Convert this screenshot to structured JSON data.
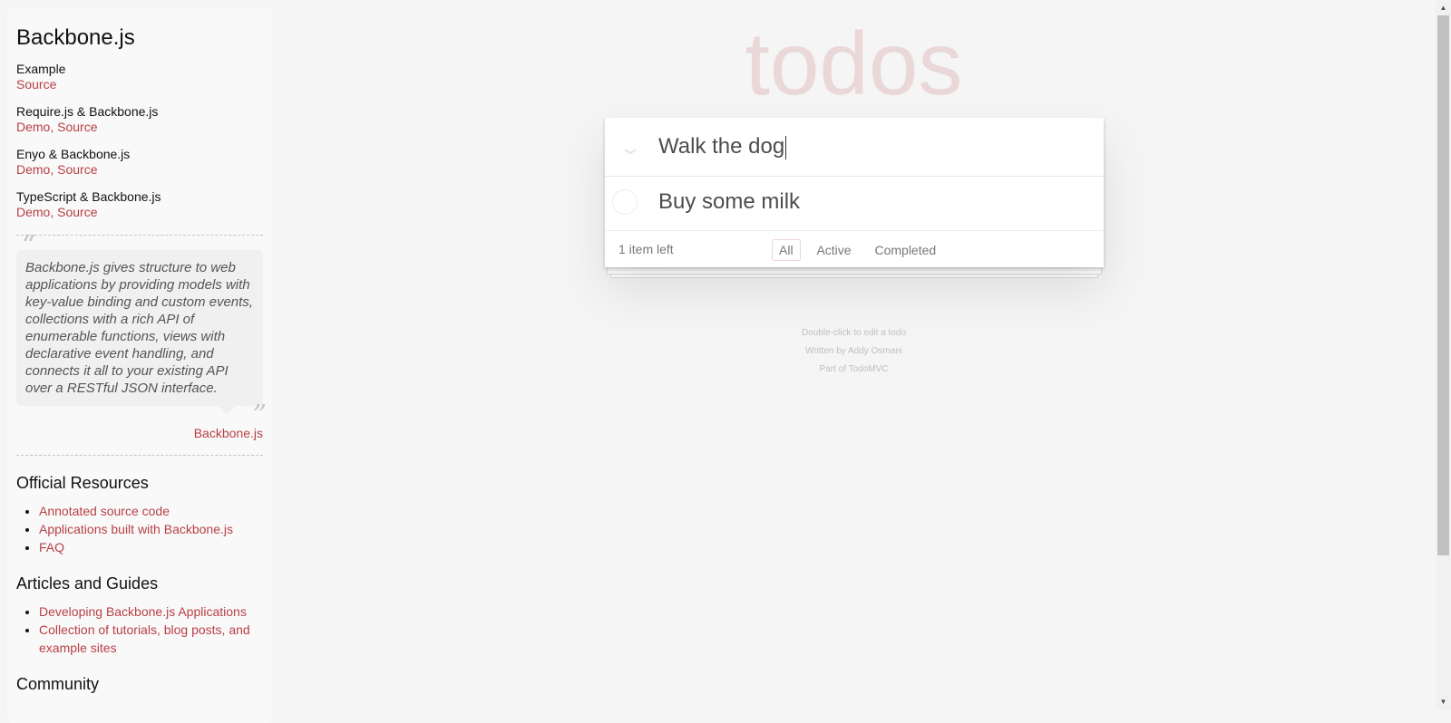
{
  "sidebar": {
    "title": "Backbone.js",
    "examples": [
      {
        "name": "Example",
        "links": "Source"
      },
      {
        "name": "Require.js & Backbone.js",
        "links": "Demo, Source"
      },
      {
        "name": "Enyo & Backbone.js",
        "links": "Demo, Source"
      },
      {
        "name": "TypeScript & Backbone.js",
        "links": "Demo, Source"
      }
    ],
    "quote": "Backbone.js gives structure to web applications by providing models with key-value binding and custom events, collections with a rich API of enumerable functions, views with declarative event handling, and connects it all to your existing API over a RESTful JSON interface.",
    "quote_source": "Backbone.js",
    "official_heading": "Official Resources",
    "official_items": [
      "Annotated source code",
      "Applications built with Backbone.js",
      "FAQ"
    ],
    "articles_heading": "Articles and Guides",
    "articles_items": [
      "Developing Backbone.js Applications",
      "Collection of tutorials, blog posts, and example sites"
    ],
    "community_heading": "Community"
  },
  "app": {
    "title": "todos",
    "new_todo_value": "Walk the dog",
    "todos": [
      {
        "label": "Buy some milk",
        "completed": false
      }
    ],
    "count": "1 item left",
    "filters": [
      "All",
      "Active",
      "Completed"
    ],
    "selected_filter": "All"
  },
  "info": {
    "line1": "Double-click to edit a todo",
    "line2": "Written by Addy Osmani",
    "line3": "Part of TodoMVC"
  }
}
